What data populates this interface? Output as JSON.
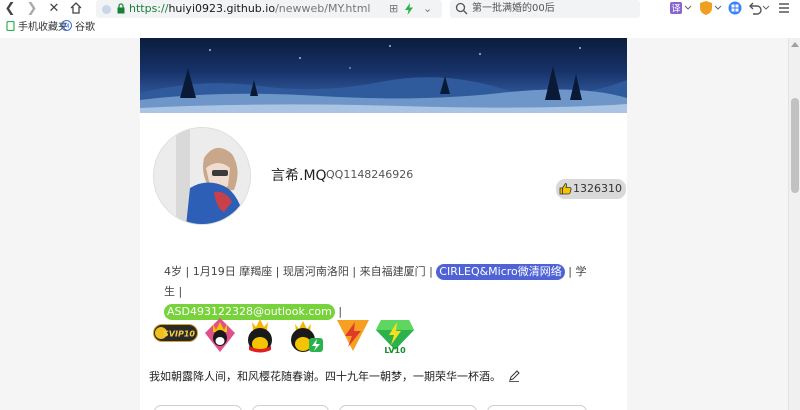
{
  "browser": {
    "url_scheme": "https://",
    "url_host": "huiyi0923.github.io",
    "url_path": "/newweb/MY.html",
    "search_placeholder": "第一批满婚的00后",
    "ext_grid": "⊞",
    "ext_arrow": "⌄",
    "icon_names": [
      "back-icon",
      "forward-icon",
      "close-icon",
      "home-icon",
      "lock-icon",
      "search-icon",
      "extensions-icon",
      "shield-icon",
      "apps-icon",
      "undo-icon",
      "menu-icon"
    ]
  },
  "bookmarks": [
    {
      "label": "手机收藏夹"
    },
    {
      "label": "谷歌"
    }
  ],
  "profile": {
    "name": "言希.MQ",
    "qq": "QQ1148246926",
    "likes": "1326310",
    "info_text": "4岁 | 1月19日 摩羯座 | 现居河南洛阳 | 来自福建厦门 | ",
    "chip_blue": "CIRLEQ&Micro微清网络",
    "after_blue": " | 学生 | ",
    "chip_green": "ASD493122328@outlook.com",
    "after_green": " |",
    "badges": [
      {
        "name": "svip-badge",
        "label": "SVIP10"
      },
      {
        "name": "crown-penguin-badge"
      },
      {
        "name": "vip-penguin-badge"
      },
      {
        "name": "lightning-penguin-badge"
      },
      {
        "name": "lightning-shield-badge"
      },
      {
        "name": "level-gem-badge",
        "label": "LV10"
      }
    ],
    "motto": "我如朝露降人间，和风樱花随春谢。四十九年一朝梦，一期荣华一杯酒。"
  },
  "colors": {
    "chip_blue": "#4f63d6",
    "chip_green": "#78d23a",
    "url_green": "#1a7f37"
  }
}
